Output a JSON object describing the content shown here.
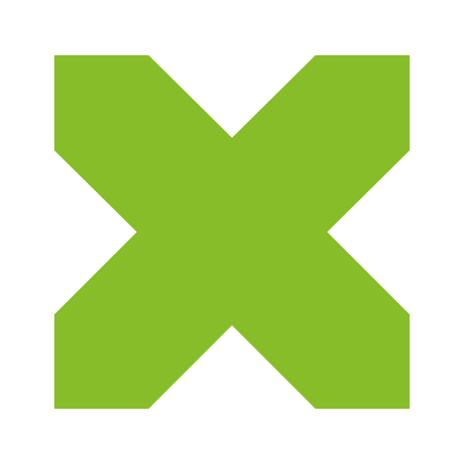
{
  "icon": {
    "name": "close-icon",
    "color": "#87bd28",
    "background": "#ffffff"
  }
}
